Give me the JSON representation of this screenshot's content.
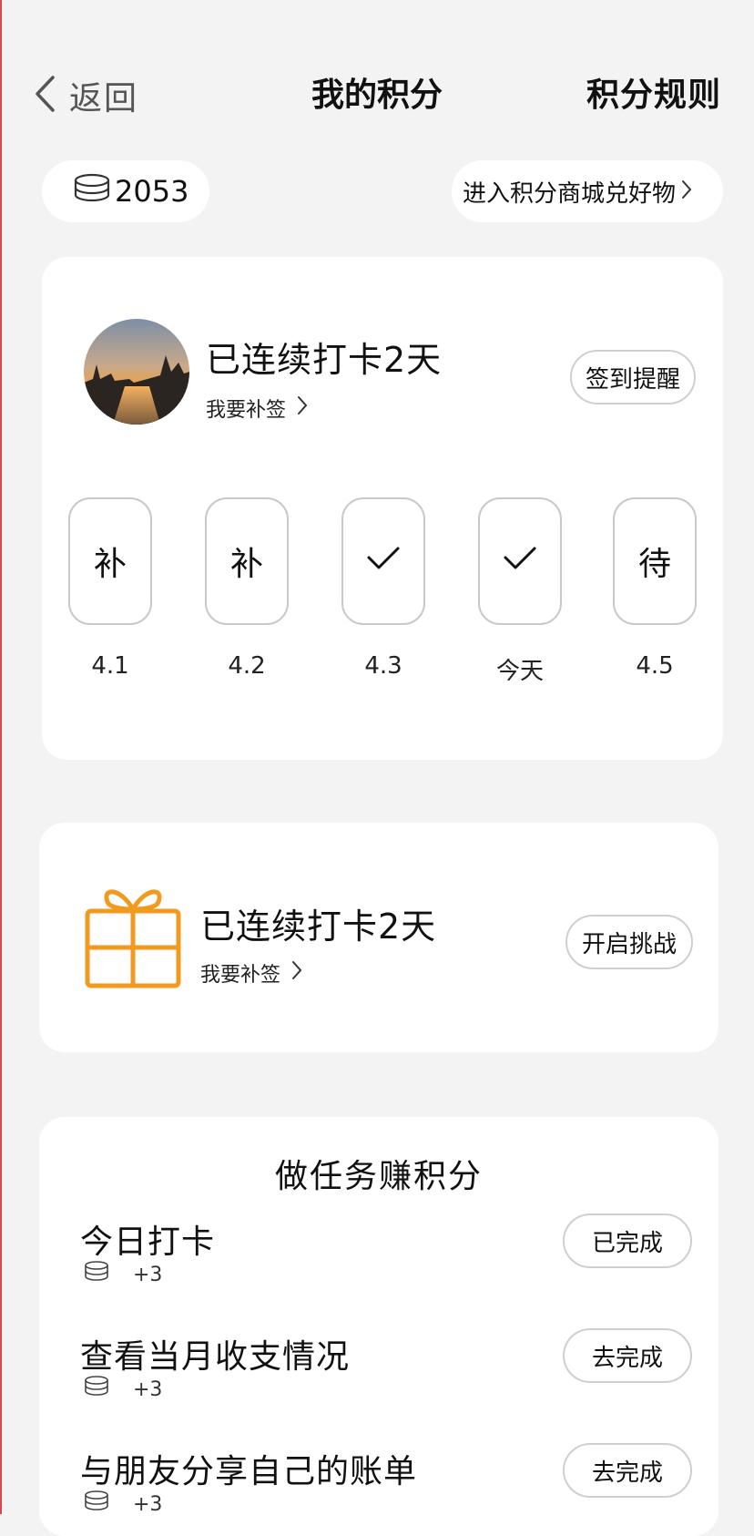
{
  "header": {
    "back_label": "返回",
    "title": "我的积分",
    "rules_label": "积分规则"
  },
  "points": {
    "balance": "2053",
    "mall_label": "进入积分商城兑好物"
  },
  "checkin_card": {
    "streak_text": "已连续打卡2天",
    "makeup_label": "我要补签",
    "reminder_button": "签到提醒",
    "days": [
      {
        "mark": "补",
        "label": "4.1",
        "state": "makeup"
      },
      {
        "mark": "补",
        "label": "4.2",
        "state": "makeup"
      },
      {
        "mark": "",
        "label": "4.3",
        "state": "checked"
      },
      {
        "mark": "",
        "label": "今天",
        "state": "checked"
      },
      {
        "mark": "待",
        "label": "4.5",
        "state": "pending"
      }
    ]
  },
  "challenge_card": {
    "streak_text": "已连续打卡2天",
    "makeup_label": "我要补签",
    "challenge_button": "开启挑战",
    "icon": "gift-icon",
    "icon_color": "#f29a1f"
  },
  "tasks": {
    "section_title": "做任务赚积分",
    "items": [
      {
        "name": "今日打卡",
        "reward": "+3",
        "button": "已完成"
      },
      {
        "name": "查看当月收支情况",
        "reward": "+3",
        "button": "去完成"
      },
      {
        "name": "与朋友分享自己的账单",
        "reward": "+3",
        "button": "去完成"
      }
    ]
  }
}
